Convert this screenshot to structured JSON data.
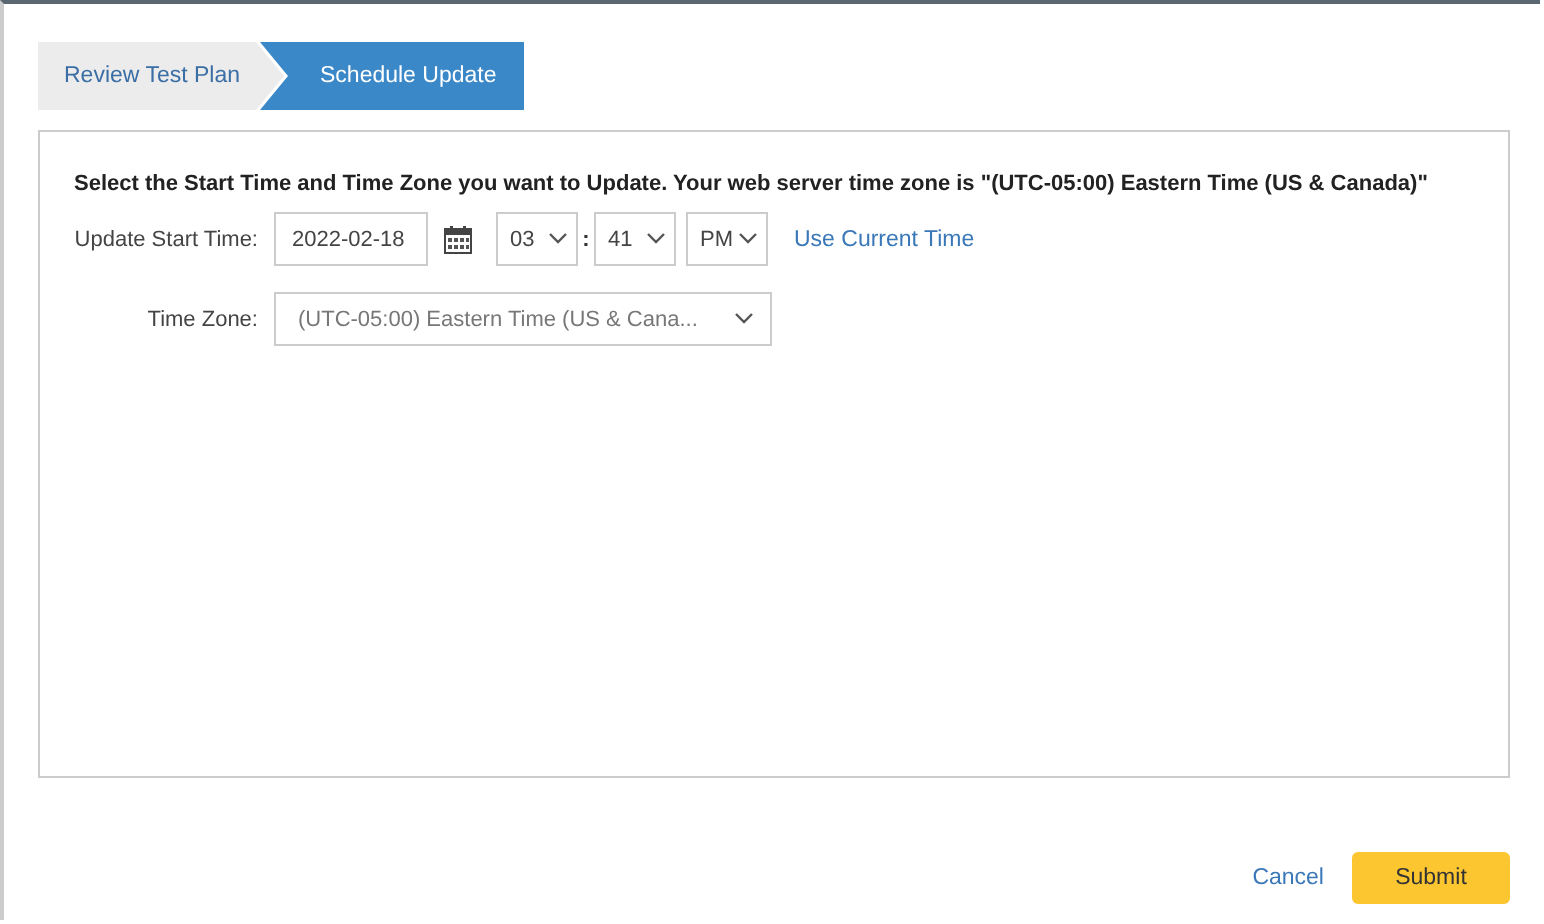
{
  "steps": [
    {
      "label": "Review Test Plan",
      "selected": false
    },
    {
      "label": "Schedule Update",
      "selected": true
    }
  ],
  "heading": "Select the Start Time and Time Zone you want to Update. Your web server time zone is \"(UTC-05:00) Eastern Time (US & Canada)\"",
  "start_time": {
    "label": "Update Start Time:",
    "date": "2022-02-18",
    "hour": "03",
    "separator": ":",
    "minute": "41",
    "ampm": "PM",
    "link": "Use Current Time"
  },
  "time_zone": {
    "label": "Time Zone:",
    "value": "(UTC-05:00) Eastern Time (US & Cana..."
  },
  "buttons": [
    {
      "label": "Cancel",
      "kind": "link"
    },
    {
      "label": "Submit",
      "kind": "primary"
    }
  ]
}
